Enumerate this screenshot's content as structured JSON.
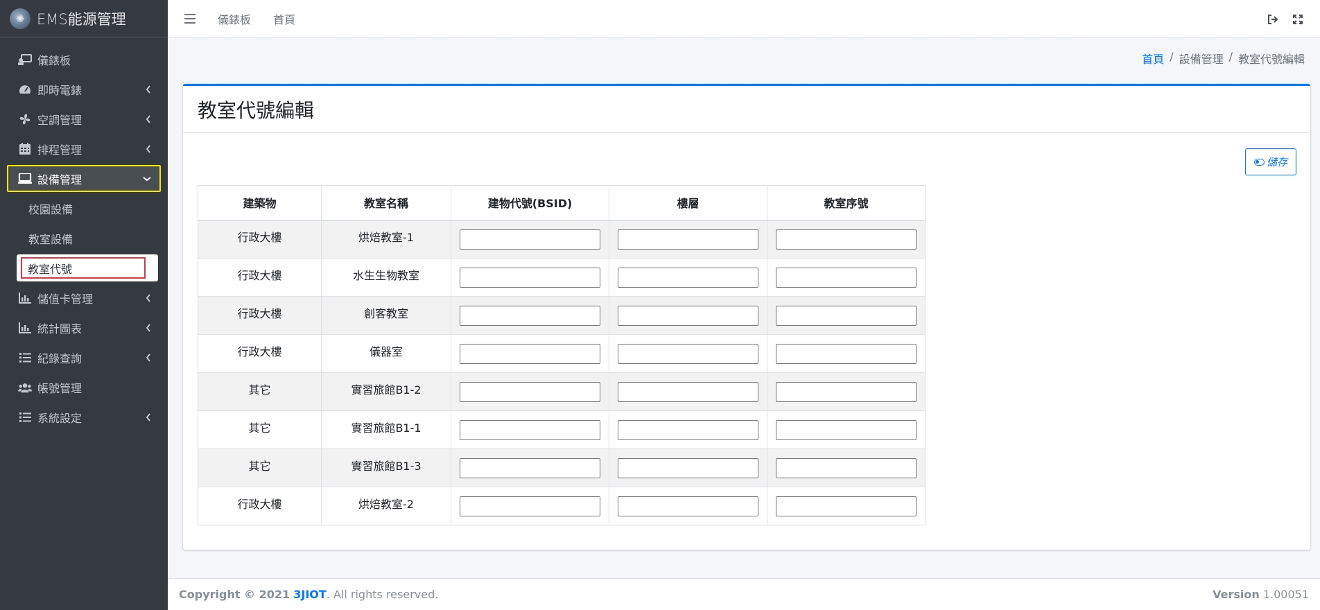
{
  "brand": {
    "title": "EMS能源管理"
  },
  "sidebar": {
    "items": [
      {
        "label": "儀錶板",
        "icon": "dashboard-icon",
        "has_chevron": false
      },
      {
        "label": "即時電錶",
        "icon": "gauge-icon",
        "has_chevron": true
      },
      {
        "label": "空調管理",
        "icon": "fan-icon",
        "has_chevron": true
      },
      {
        "label": "排程管理",
        "icon": "calendar-icon",
        "has_chevron": true
      },
      {
        "label": "設備管理",
        "icon": "laptop-icon",
        "has_chevron": true,
        "active": true
      },
      {
        "label": "儲值卡管理",
        "icon": "bar-chart-icon",
        "has_chevron": true
      },
      {
        "label": "統計圖表",
        "icon": "bar-chart-icon",
        "has_chevron": true
      },
      {
        "label": "紀錄查詢",
        "icon": "list-icon",
        "has_chevron": true
      },
      {
        "label": "帳號管理",
        "icon": "users-icon",
        "has_chevron": false
      },
      {
        "label": "系統設定",
        "icon": "list-icon",
        "has_chevron": true
      }
    ],
    "submenu": [
      {
        "label": "校園設備"
      },
      {
        "label": "教室設備"
      },
      {
        "label": "教室代號",
        "selected": true
      }
    ]
  },
  "topbar": {
    "links": [
      "儀錶板",
      "首頁"
    ]
  },
  "breadcrumb": {
    "home": "首頁",
    "level2": "設備管理",
    "current": "教室代號編輯"
  },
  "card": {
    "title": "教室代號編輯",
    "save_label": "儲存"
  },
  "table": {
    "headers": [
      "建築物",
      "教室名稱",
      "建物代號(BSID)",
      "樓層",
      "教室序號"
    ],
    "rows": [
      {
        "building": "行政大樓",
        "room": "烘焙教室-1",
        "bsid": "",
        "floor": "",
        "serial": ""
      },
      {
        "building": "行政大樓",
        "room": "水生生物教室",
        "bsid": "",
        "floor": "",
        "serial": ""
      },
      {
        "building": "行政大樓",
        "room": "創客教室",
        "bsid": "",
        "floor": "",
        "serial": ""
      },
      {
        "building": "行政大樓",
        "room": "儀器室",
        "bsid": "",
        "floor": "",
        "serial": ""
      },
      {
        "building": "其它",
        "room": "實習旅館B1-2",
        "bsid": "",
        "floor": "",
        "serial": ""
      },
      {
        "building": "其它",
        "room": "實習旅館B1-1",
        "bsid": "",
        "floor": "",
        "serial": ""
      },
      {
        "building": "其它",
        "room": "實習旅館B1-3",
        "bsid": "",
        "floor": "",
        "serial": ""
      },
      {
        "building": "行政大樓",
        "room": "烘焙教室-2",
        "bsid": "",
        "floor": "",
        "serial": ""
      }
    ]
  },
  "footer": {
    "copyright_prefix": "Copyright © 2021",
    "company": "3JIOT",
    "rights": ". All rights reserved.",
    "version_label": "Version",
    "version_number": "1.00051"
  },
  "colors": {
    "sidebar_bg": "#343a40",
    "accent": "#007bff",
    "active_outline": "#f5e800",
    "selected_outline": "#dc3545"
  }
}
